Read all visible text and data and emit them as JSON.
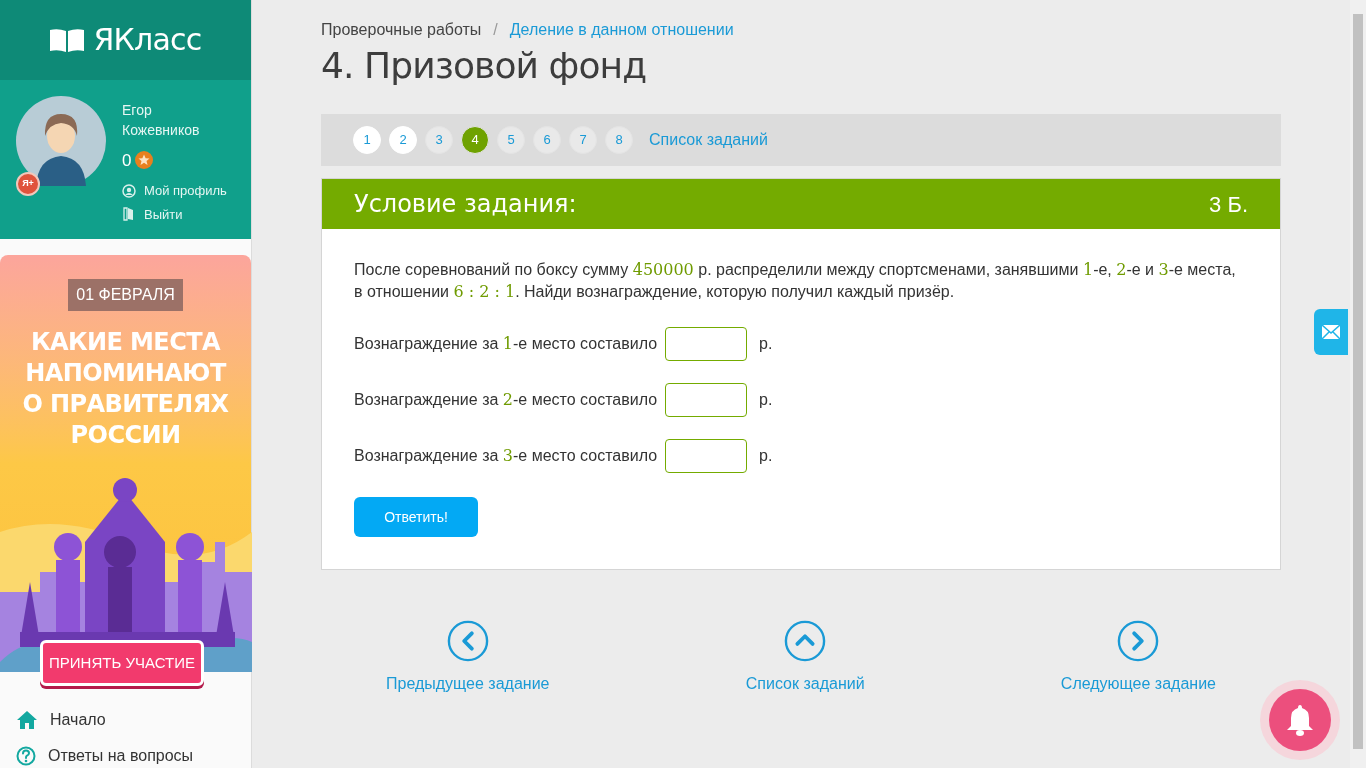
{
  "sidebar": {
    "logo": "ЯКласс",
    "user": {
      "first_name": "Егор",
      "last_name": "Кожевников",
      "points": "0",
      "badge": "Я+",
      "links": [
        {
          "kind": "profile",
          "label": "Мой профиль"
        },
        {
          "kind": "logout",
          "label": "Выйти"
        }
      ]
    },
    "banner": {
      "date": "01 ФЕВРАЛЯ",
      "headline": "КАКИЕ МЕСТА НАПОМИНАЮТ О ПРАВИТЕЛЯХ РОССИИ",
      "button": "ПРИНЯТЬ УЧАСТИЕ"
    },
    "nav": [
      {
        "kind": "home",
        "label": "Начало"
      },
      {
        "kind": "help",
        "label": "Ответы на вопросы"
      }
    ]
  },
  "breadcrumbs": [
    {
      "label": "Проверочные работы",
      "link": false
    },
    {
      "label": "Деление в данном отношении",
      "link": true
    }
  ],
  "breadcrumb_separator": "/",
  "title": "4. Призовой фонд",
  "pager": {
    "pages": [
      {
        "label": "1",
        "selected": false,
        "visited": true
      },
      {
        "label": "2",
        "selected": false,
        "visited": true
      },
      {
        "label": "3",
        "selected": false,
        "visited": false
      },
      {
        "label": "4",
        "selected": true,
        "visited": false
      },
      {
        "label": "5",
        "selected": false,
        "visited": false
      },
      {
        "label": "6",
        "selected": false,
        "visited": false
      },
      {
        "label": "7",
        "selected": false,
        "visited": false
      },
      {
        "label": "8",
        "selected": false,
        "visited": false
      }
    ],
    "list_link": "Список заданий"
  },
  "task": {
    "heading": "Условие задания:",
    "score": "3 Б.",
    "statement": [
      {
        "kind": "text",
        "text": "После соревнований по боксу сумму "
      },
      {
        "kind": "math",
        "text": "450000"
      },
      {
        "kind": "text",
        "text": " р. распределили между спортсменами, занявшими "
      },
      {
        "kind": "math",
        "text": "1"
      },
      {
        "kind": "text",
        "text": "-е, "
      },
      {
        "kind": "math",
        "text": "2"
      },
      {
        "kind": "text",
        "text": "-е и "
      },
      {
        "kind": "math",
        "text": "3"
      },
      {
        "kind": "text",
        "text": "-е места, в отношении "
      },
      {
        "kind": "math",
        "text": "6 : 2 : 1"
      },
      {
        "kind": "text",
        "text": ". Найди вознаграждение, которую получил каждый призёр."
      }
    ],
    "answers": [
      {
        "label": [
          {
            "kind": "text",
            "text": "Вознаграждение за "
          },
          {
            "kind": "math",
            "text": "1"
          },
          {
            "kind": "text",
            "text": "-е место составило"
          }
        ],
        "unit": "р."
      },
      {
        "label": [
          {
            "kind": "text",
            "text": "Вознаграждение за "
          },
          {
            "kind": "math",
            "text": "2"
          },
          {
            "kind": "text",
            "text": "-е место составило"
          }
        ],
        "unit": "р."
      },
      {
        "label": [
          {
            "kind": "text",
            "text": "Вознаграждение за "
          },
          {
            "kind": "math",
            "text": "3"
          },
          {
            "kind": "text",
            "text": "-е место составило"
          }
        ],
        "unit": "р."
      }
    ],
    "submit": "Ответить!"
  },
  "bottom_nav": [
    {
      "kind": "prev",
      "label": "Предыдущее задание"
    },
    {
      "kind": "list",
      "label": "Список заданий"
    },
    {
      "kind": "next",
      "label": "Следующее задание"
    }
  ]
}
